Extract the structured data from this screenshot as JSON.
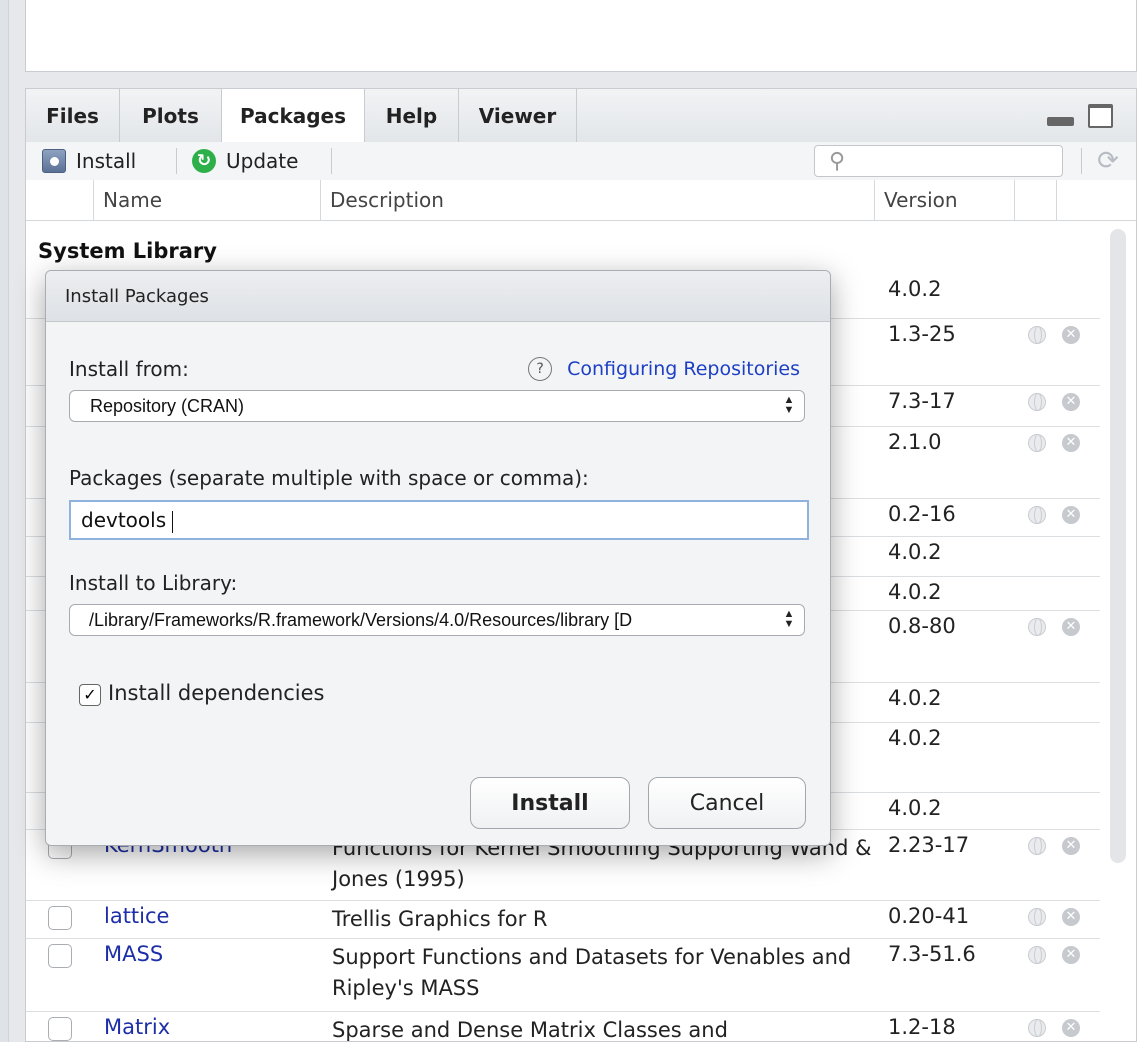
{
  "tabs": [
    "Files",
    "Plots",
    "Packages",
    "Help",
    "Viewer"
  ],
  "toolbar": {
    "install_label": "Install",
    "update_label": "Update"
  },
  "table": {
    "headers": {
      "name": "Name",
      "description": "Description",
      "version": "Version"
    },
    "section_title": "System Library",
    "versions_behind_dialog": [
      "4.0.2",
      "1.3-25",
      "7.3-17",
      "2.1.0",
      "0.2-16",
      "4.0.2",
      "4.0.2",
      "0.8-80",
      "4.0.2",
      "4.0.2",
      "4.0.2"
    ],
    "visible_rows": [
      {
        "name": "KernSmooth",
        "description": "Functions for Kernel Smoothing Supporting Wand & Jones (1995)",
        "version": "2.23-17"
      },
      {
        "name": "lattice",
        "description": "Trellis Graphics for R",
        "version": "0.20-41"
      },
      {
        "name": "MASS",
        "description": "Support Functions and Datasets for Venables and Ripley's MASS",
        "version": "7.3-51.6"
      },
      {
        "name": "Matrix",
        "description": "Sparse and Dense Matrix Classes and",
        "version": "1.2-18"
      }
    ]
  },
  "dialog": {
    "title": "Install Packages",
    "install_from_label": "Install from:",
    "help_link": "Configuring Repositories",
    "install_from_value": "Repository (CRAN)",
    "packages_label": "Packages (separate multiple with space or comma):",
    "packages_value": "devtools",
    "library_label": "Install to Library:",
    "library_value": "/Library/Frameworks/R.framework/Versions/4.0/Resources/library [D",
    "dependencies_label": "Install dependencies",
    "dependencies_checked": true,
    "install_button": "Install",
    "cancel_button": "Cancel"
  }
}
